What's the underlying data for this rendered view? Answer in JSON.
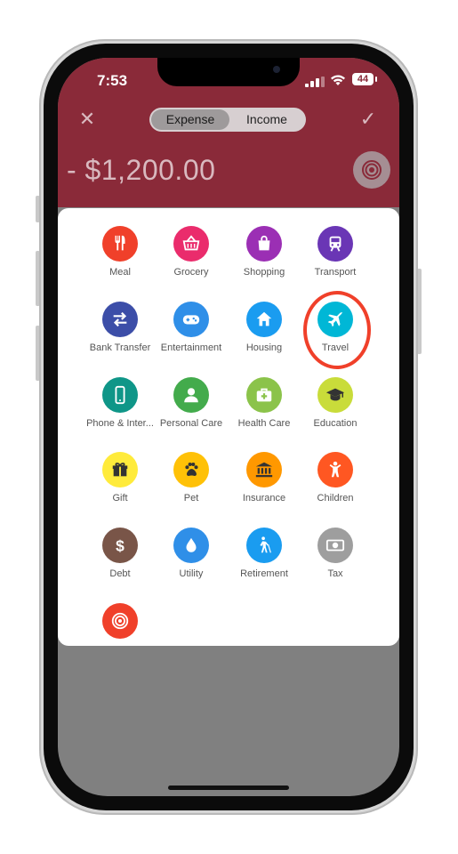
{
  "status": {
    "time": "7:53",
    "battery": "44"
  },
  "nav": {
    "segments": [
      "Expense",
      "Income"
    ],
    "active_segment": "Expense",
    "close_icon": "close-icon",
    "confirm_icon": "check-icon"
  },
  "amount": "- $1,200.00",
  "colors": {
    "header": "#8a2a39",
    "highlight": "#f0402a"
  },
  "categories": [
    {
      "label": "Meal",
      "icon": "fork-knife-icon",
      "color": "#f0402a"
    },
    {
      "label": "Grocery",
      "icon": "basket-icon",
      "color": "#ea2c6c"
    },
    {
      "label": "Shopping",
      "icon": "bag-icon",
      "color": "#9b2fb4"
    },
    {
      "label": "Transport",
      "icon": "train-icon",
      "color": "#6a36b5"
    },
    {
      "label": "Bank Transfer",
      "icon": "transfer-arrows-icon",
      "color": "#3c4ea8"
    },
    {
      "label": "Entertainment",
      "icon": "gamepad-icon",
      "color": "#2f8fe8"
    },
    {
      "label": "Housing",
      "icon": "house-icon",
      "color": "#1a9cf0"
    },
    {
      "label": "Travel",
      "icon": "airplane-icon",
      "color": "#00b7d6"
    },
    {
      "label": "Phone & Inter...",
      "icon": "phone-icon",
      "color": "#0f9688"
    },
    {
      "label": "Personal Care",
      "icon": "person-icon",
      "color": "#43ab4c"
    },
    {
      "label": "Health Care",
      "icon": "medical-kit-icon",
      "color": "#8bc34a"
    },
    {
      "label": "Education",
      "icon": "graduation-cap-icon",
      "color": "#c9dc3a"
    },
    {
      "label": "Gift",
      "icon": "gift-icon",
      "color": "#ffeb3b"
    },
    {
      "label": "Pet",
      "icon": "paw-icon",
      "color": "#ffc107"
    },
    {
      "label": "Insurance",
      "icon": "bank-building-icon",
      "color": "#ff9800"
    },
    {
      "label": "Children",
      "icon": "child-icon",
      "color": "#ff5722"
    },
    {
      "label": "Debt",
      "icon": "dollar-icon",
      "color": "#795548"
    },
    {
      "label": "Utility",
      "icon": "water-drop-icon",
      "color": "#2f8fe8"
    },
    {
      "label": "Retirement",
      "icon": "walking-cane-icon",
      "color": "#1a9cf0"
    },
    {
      "label": "Tax",
      "icon": "cash-icon",
      "color": "#9e9e9e"
    },
    {
      "label": "",
      "icon": "target-icon",
      "color": "#f0402a"
    }
  ]
}
